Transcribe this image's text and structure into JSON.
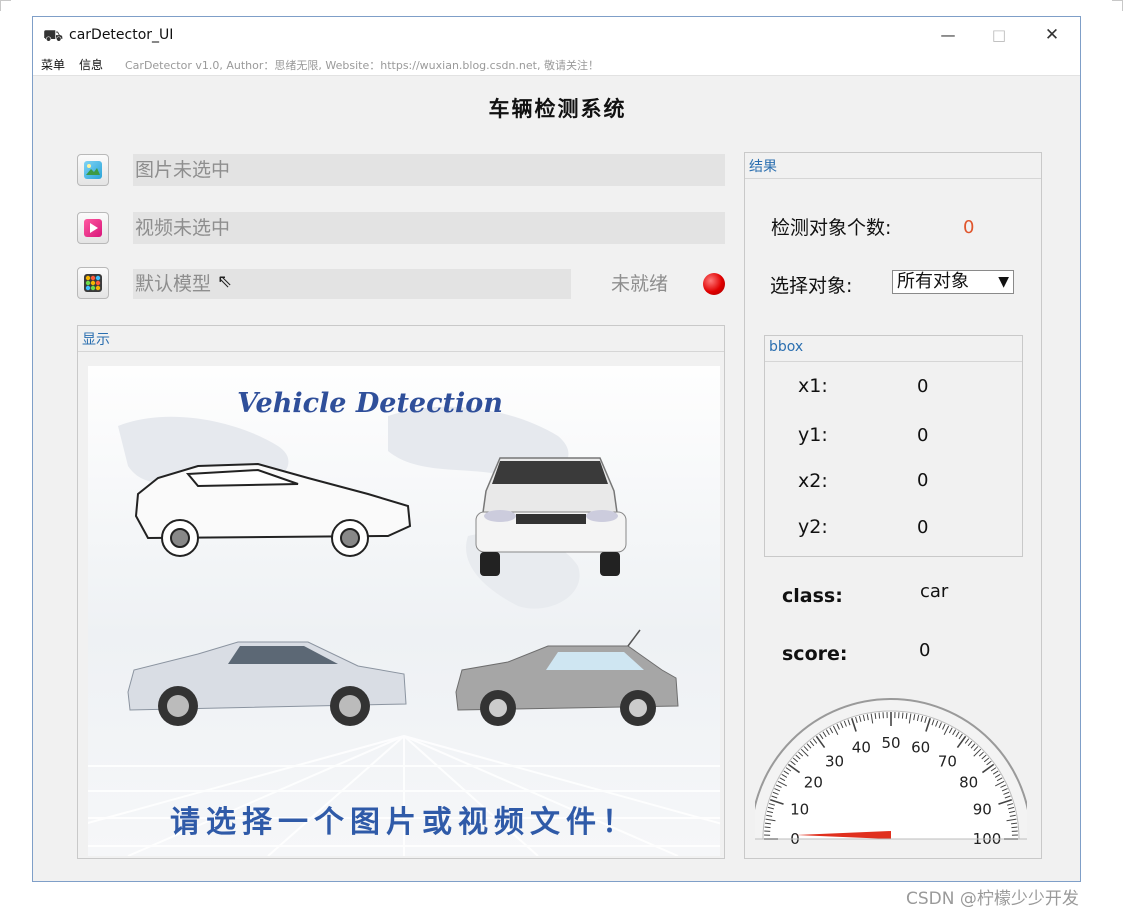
{
  "window": {
    "title": "carDetector_UI",
    "minimize": "—",
    "maximize": "□",
    "close": "✕"
  },
  "menu": {
    "items": [
      "菜单",
      "信息"
    ],
    "info_text": "CarDetector v1.0, Author：思绪无限, Website：https://wuxian.blog.csdn.net, 敬请关注！"
  },
  "app_title": "车辆检测系统",
  "inputs": {
    "image_field": "图片未选中",
    "video_field": "视频未选中",
    "model_field": "默认模型",
    "model_status": "未就绪"
  },
  "display": {
    "group_title": "显示",
    "banner_title": "Vehicle Detection",
    "prompt": "请选择一个图片或视频文件！"
  },
  "results": {
    "group_title": "结果",
    "count_label": "检测对象个数:",
    "count_value": "0",
    "select_label": "选择对象:",
    "select_value": "所有对象",
    "bbox": {
      "title": "bbox",
      "rows": [
        {
          "label": "x1:",
          "value": "0"
        },
        {
          "label": "y1:",
          "value": "0"
        },
        {
          "label": "x2:",
          "value": "0"
        },
        {
          "label": "y2:",
          "value": "0"
        }
      ]
    },
    "class_label": "class:",
    "class_value": "car",
    "score_label": "score:",
    "score_value": "0",
    "gauge": {
      "ticks": [
        "0",
        "10",
        "20",
        "30",
        "40",
        "50",
        "60",
        "70",
        "80",
        "90",
        "100"
      ],
      "value": 0
    }
  },
  "watermark": "CSDN @柠檬少少开发",
  "colors": {
    "accent": "#2b6fb0",
    "count": "#e0552c",
    "status_red": "#e00000",
    "window_border": "#7f9fc8"
  }
}
